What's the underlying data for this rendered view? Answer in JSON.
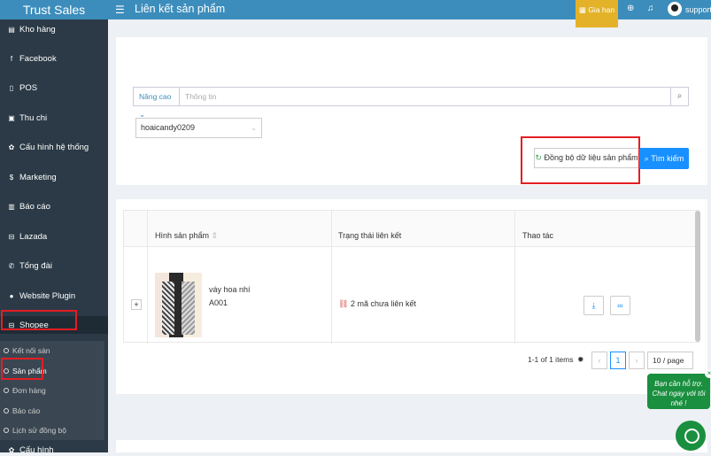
{
  "sidebar": {
    "brand": "Trust Sales",
    "items": [
      {
        "label": "Kho hàng",
        "icon": "warehouse-icon"
      },
      {
        "label": "Facebook",
        "icon": "facebook-icon"
      },
      {
        "label": "POS",
        "icon": "pos-icon"
      },
      {
        "label": "Thu chi",
        "icon": "money-icon"
      },
      {
        "label": "Cấu hình hệ thống",
        "icon": "gear-icon"
      },
      {
        "label": "Marketing",
        "icon": "dollar-icon"
      },
      {
        "label": "Báo cáo",
        "icon": "chart-icon"
      },
      {
        "label": "Lazada",
        "icon": "cart-icon"
      },
      {
        "label": "Tổng đài",
        "icon": "phone-icon"
      },
      {
        "label": "Website Plugin",
        "icon": "globe-icon"
      },
      {
        "label": "Shopee",
        "icon": "cart-icon"
      }
    ],
    "shopee_sub": [
      "Kết nối sàn",
      "Sản phẩm",
      "Đơn hàng",
      "Báo cáo",
      "Lịch sử đồng bộ"
    ],
    "last_item": "Cấu hình"
  },
  "topbar": {
    "title": "Liên kết sản phẩm",
    "limit_label": "Gia hạn",
    "user": "support"
  },
  "filter": {
    "advanced_label": "Nâng cao",
    "search_placeholder": "Thông tin",
    "shop_value": "hoaicandy0209",
    "sync_label": "Đồng bộ dữ liệu sản phẩm",
    "search_label": "Tìm kiếm"
  },
  "table": {
    "headers": [
      "Hình sản phẩm",
      "Trạng thái liên kết",
      "Thao tác"
    ],
    "rows": [
      {
        "name": "váy hoa nhí",
        "sku": "A001",
        "status": "2 mã chưa liên kết"
      }
    ]
  },
  "pagination": {
    "range_text": "1-1 of 1 items",
    "current_page": "1",
    "page_size": "10 / page"
  },
  "chat": {
    "bubble_text": "Bạn cần hỗ trợ. Chat ngay với tôi nhé !"
  },
  "colors": {
    "accent": "#3c8dbc",
    "sidebar": "#2b3a46",
    "primary_button": "#1890ff",
    "highlight": "#e31e24",
    "chat": "#1a8f3f"
  }
}
